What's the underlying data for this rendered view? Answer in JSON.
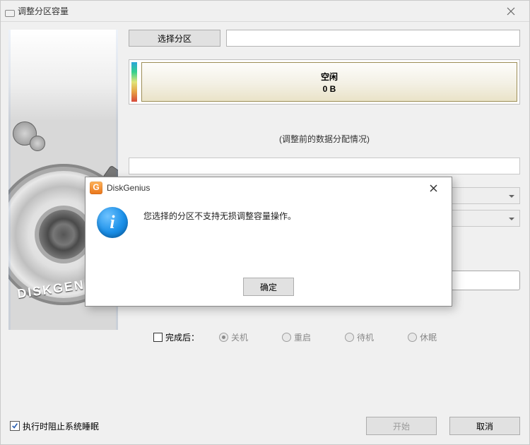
{
  "window": {
    "title": "调整分区容量"
  },
  "toolbar": {
    "select_partition_button": "选择分区"
  },
  "partition": {
    "name": "空闲",
    "size": "0 B"
  },
  "caption": {
    "before_adjust": "(调整前的数据分配情况)"
  },
  "after_options": {
    "checkbox_label": "完成后：",
    "radios": {
      "shutdown": "关机",
      "reboot": "重启",
      "standby": "待机",
      "hibernate": "休眠"
    },
    "selected": "shutdown"
  },
  "bottom": {
    "prevent_sleep_label": "执行时阻止系统睡眠",
    "prevent_sleep_checked": true,
    "start_button": "开始",
    "cancel_button": "取消"
  },
  "modal": {
    "app_icon_letter": "G",
    "title": "DiskGenius",
    "message": "您选择的分区不支持无损调整容量操作。",
    "ok_button": "确定"
  },
  "sidebar": {
    "brand": "DISKGENIUS"
  }
}
